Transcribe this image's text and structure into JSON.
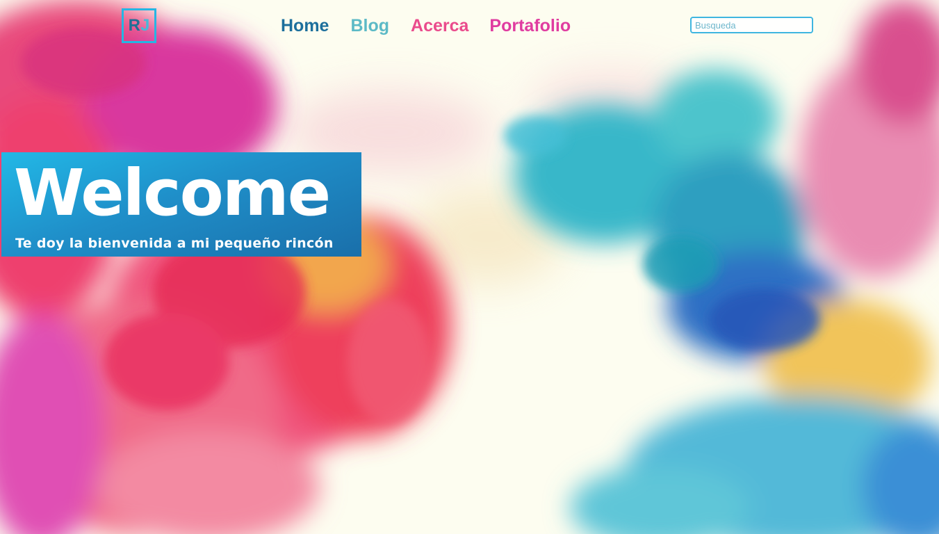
{
  "logo": {
    "text_left": "R",
    "text_right": "J"
  },
  "nav": {
    "items": [
      {
        "label": "Home",
        "color": "#1c6f9c"
      },
      {
        "label": "Blog",
        "color": "#5cbac6"
      },
      {
        "label": "Acerca",
        "color": "#ea4b8c"
      },
      {
        "label": "Portafolio",
        "color": "#e03ca0"
      }
    ]
  },
  "search": {
    "placeholder": "Busqueda",
    "value": ""
  },
  "hero": {
    "title": "Welcome",
    "subtitle": "Te doy la bienvenida a mi pequeño rincón"
  },
  "colors": {
    "accent": "#25b6e3",
    "background": "#fdfdf0"
  }
}
